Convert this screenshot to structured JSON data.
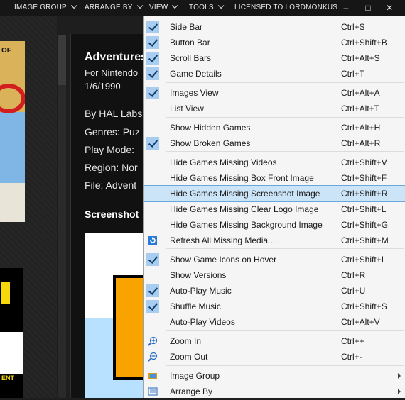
{
  "menubar": {
    "items": [
      "IMAGE GROUP",
      "ARRANGE BY",
      "VIEW",
      "TOOLS"
    ],
    "license": "LICENSED TO LORDMONKUS",
    "window_buttons": {
      "minimize": "‒",
      "maximize": "□",
      "close": "✕"
    }
  },
  "background": {
    "title": "Adventures",
    "platform": "For Nintendo",
    "date": "1/6/1990",
    "developer": "By HAL Labs",
    "genres": "Genres: Puz",
    "play_mode": "Play Mode:",
    "region": "Region: Nor",
    "file": "File: Advent",
    "screenshot_heading": "Screenshot",
    "boxart1_text": "OF",
    "boxart2_text": "ENT"
  },
  "view_menu": {
    "items": [
      {
        "label": "Side Bar",
        "shortcut": "Ctrl+S",
        "checked": true
      },
      {
        "label": "Button Bar",
        "shortcut": "Ctrl+Shift+B",
        "checked": true
      },
      {
        "label": "Scroll Bars",
        "shortcut": "Ctrl+Alt+S",
        "checked": true
      },
      {
        "label": "Game Details",
        "shortcut": "Ctrl+T",
        "checked": true
      },
      {
        "label": "Images View",
        "shortcut": "Ctrl+Alt+A",
        "checked": true
      },
      {
        "label": "List View",
        "shortcut": "Ctrl+Alt+T",
        "checked": false
      },
      {
        "label": "Show Hidden Games",
        "shortcut": "Ctrl+Alt+H",
        "checked": false
      },
      {
        "label": "Show Broken Games",
        "shortcut": "Ctrl+Alt+R",
        "checked": true
      },
      {
        "label": "Hide Games Missing Videos",
        "shortcut": "Ctrl+Shift+V",
        "checked": false
      },
      {
        "label": "Hide Games Missing Box Front Image",
        "shortcut": "Ctrl+Shift+F",
        "checked": false
      },
      {
        "label": "Hide Games Missing Screenshot Image",
        "shortcut": "Ctrl+Shift+R",
        "checked": false,
        "highlighted": true
      },
      {
        "label": "Hide Games Missing Clear Logo Image",
        "shortcut": "Ctrl+Shift+L",
        "checked": false
      },
      {
        "label": "Hide Games Missing Background Image",
        "shortcut": "Ctrl+Shift+G",
        "checked": false
      },
      {
        "label": "Refresh All Missing Media....",
        "shortcut": "Ctrl+Shift+M",
        "icon": "refresh-icon"
      },
      {
        "label": "Show Game Icons on Hover",
        "shortcut": "Ctrl+Shift+I",
        "checked": true
      },
      {
        "label": "Show Versions",
        "shortcut": "Ctrl+R",
        "checked": false
      },
      {
        "label": "Auto-Play Music",
        "shortcut": "Ctrl+U",
        "checked": true
      },
      {
        "label": "Shuffle Music",
        "shortcut": "Ctrl+Shift+S",
        "checked": true
      },
      {
        "label": "Auto-Play Videos",
        "shortcut": "Ctrl+Alt+V",
        "checked": false
      },
      {
        "label": "Zoom In",
        "shortcut": "Ctrl++",
        "icon": "zoom-in-icon"
      },
      {
        "label": "Zoom Out",
        "shortcut": "Ctrl+-",
        "icon": "zoom-out-icon"
      },
      {
        "label": "Image Group",
        "shortcut": "",
        "icon": "image-group-icon",
        "submenu": true
      },
      {
        "label": "Arrange By",
        "shortcut": "",
        "icon": "arrange-by-icon",
        "submenu": true
      }
    ]
  }
}
